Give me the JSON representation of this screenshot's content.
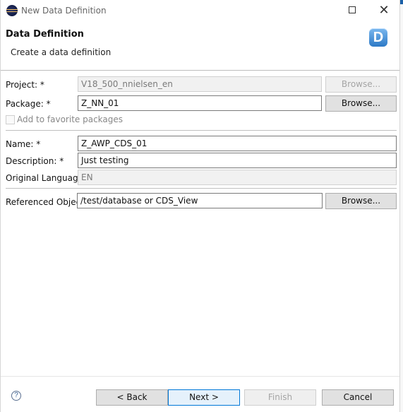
{
  "window": {
    "title": "New Data Definition",
    "controls": {
      "minimize_icon": "minimize-icon",
      "maximize_icon": "maximize-icon",
      "close_icon": "close-icon",
      "close_glyph": "✕"
    }
  },
  "header": {
    "title": "Data Definition",
    "subtitle": "Create a data definition",
    "logo_letter": "D"
  },
  "form": {
    "project": {
      "label": "Project: *",
      "value": "V18_500_nnielsen_en",
      "browse_label": "Browse..."
    },
    "package": {
      "label": "Package: *",
      "value": "Z_NN_01",
      "browse_label": "Browse..."
    },
    "favorite": {
      "label": "Add to favorite packages",
      "checked": false
    },
    "name": {
      "label": "Name: *",
      "value": "Z_AWP_CDS_01"
    },
    "description": {
      "label": "Description: *",
      "value": "Just testing"
    },
    "original_language": {
      "label": "Original Language:",
      "value": "EN"
    },
    "referenced_object": {
      "label": "Referenced Object:",
      "value": "/test/database or CDS_View",
      "browse_label": "Browse..."
    }
  },
  "footer": {
    "help_symbol": "?",
    "back_label": "< Back",
    "next_label": "Next >",
    "finish_label": "Finish",
    "cancel_label": "Cancel"
  },
  "colors": {
    "accent": "#0078d7",
    "logo_blue": "#2c79c6",
    "disabled_text": "#a5a5a5",
    "button_face": "#e1e1e1"
  }
}
